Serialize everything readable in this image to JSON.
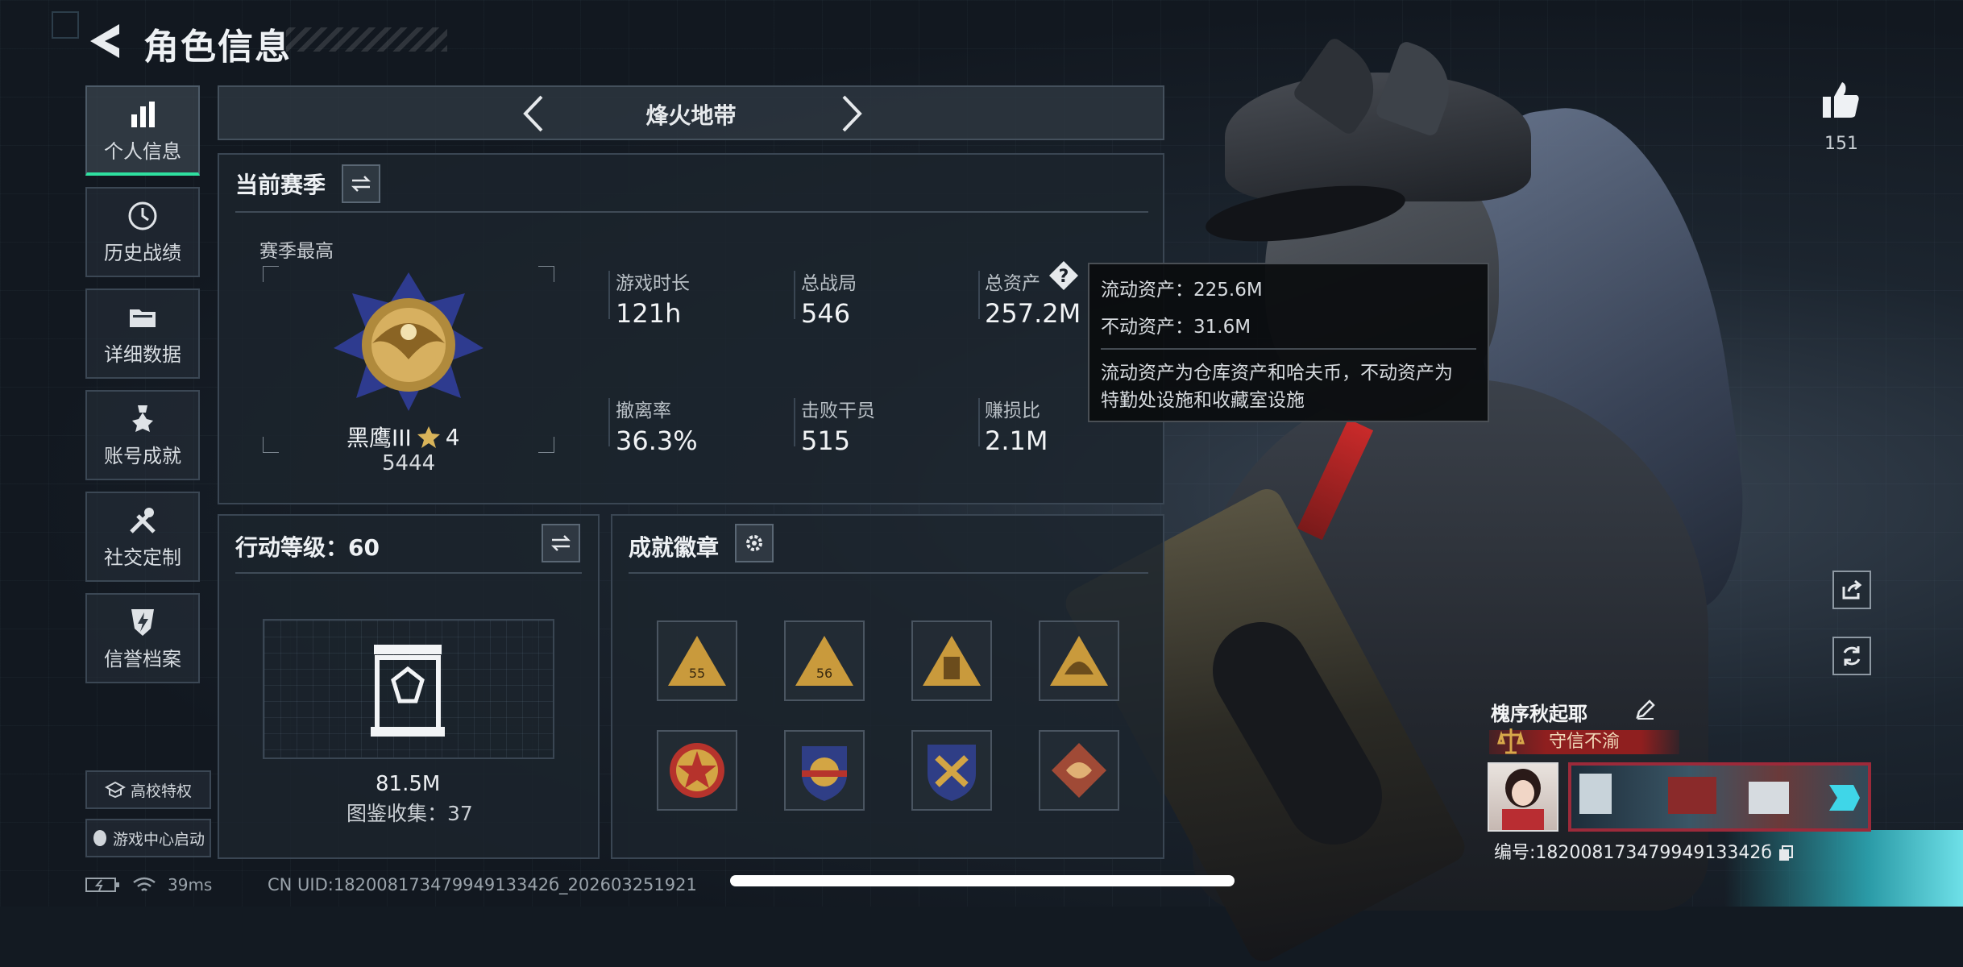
{
  "header": {
    "title": "角色信息"
  },
  "sidebar": {
    "items": [
      {
        "label": "个人信息",
        "icon": "bar-chart-icon",
        "active": true
      },
      {
        "label": "历史战绩",
        "icon": "history-clock-icon"
      },
      {
        "label": "详细数据",
        "icon": "folder-icon"
      },
      {
        "label": "账号成就",
        "icon": "achievement-medal-icon"
      },
      {
        "label": "社交定制",
        "icon": "tools-icon"
      },
      {
        "label": "信誉档案",
        "icon": "reputation-shield-icon"
      }
    ],
    "campus_label": "高校特权",
    "game_center_label": "游戏中心启动"
  },
  "mode_nav": {
    "title": "烽火地带"
  },
  "season": {
    "section_title": "当前赛季",
    "best_label": "赛季最高",
    "rank_name": "黑鹰III",
    "rank_stars": "4",
    "rank_score": "5444",
    "stats": [
      {
        "label": "游戏时长",
        "value": "121h"
      },
      {
        "label": "总战局",
        "value": "546"
      },
      {
        "label": "总资产",
        "value": "257.2M"
      },
      {
        "label": "撤离率",
        "value": "36.3%"
      },
      {
        "label": "击败干员",
        "value": "515"
      },
      {
        "label": "赚损比",
        "value": "2.1M"
      }
    ]
  },
  "tooltip": {
    "liquid": "流动资产：225.6M",
    "fixed": "不动资产：31.6M",
    "desc_line1": "流动资产为仓库资产和哈夫币，不动资产为",
    "desc_line2": "特勤处设施和收藏室设施"
  },
  "action_level": {
    "title": "行动等级：60",
    "value": "81.5M",
    "collection": "图鉴收集：37"
  },
  "achievements": {
    "title": "成就徽章",
    "badges": [
      "badge-55",
      "badge-56",
      "badge-tower",
      "badge-helmet",
      "badge-star",
      "badge-shield-stars",
      "badge-anchor",
      "badge-dragon"
    ],
    "badge_labels": [
      "55",
      "56"
    ]
  },
  "profile": {
    "name": "槐序秋起耶",
    "title_banner": "守信不渝",
    "uid_line": "编号:18200817347994913342б"
  },
  "right_panel": {
    "likes": "151"
  },
  "status": {
    "ping": "39ms",
    "footer_uid": "CN UID:18200817347994913342б_202603251921"
  },
  "colors": {
    "accent_green": "#2fe0a0",
    "banner_red": "#8f1f1f"
  }
}
